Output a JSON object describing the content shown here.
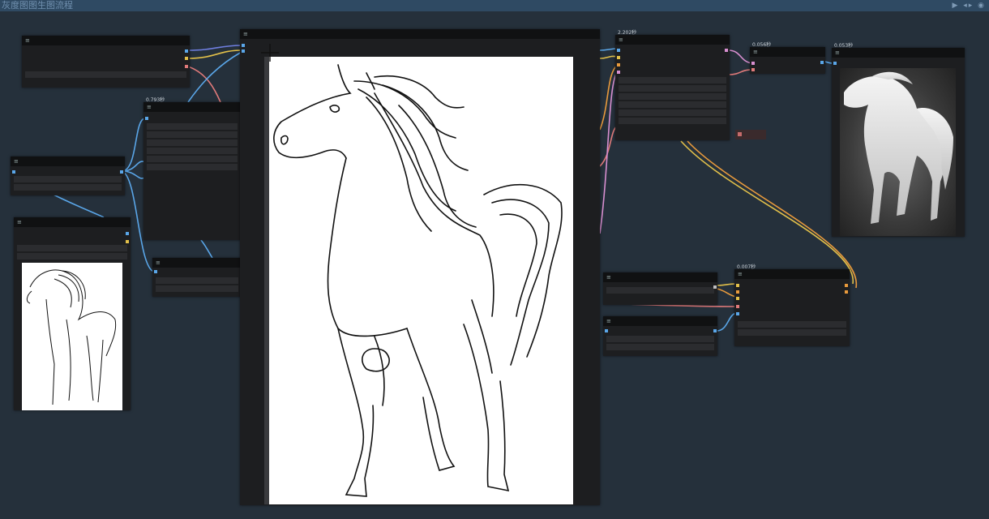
{
  "window": {
    "title": "灰度图图生图流程",
    "controls": "▶ ◂▸ ◉"
  },
  "nodes": {
    "load_image_node": {
      "menu": "≡"
    },
    "preprocess_node": {
      "menu": "≡",
      "timing": "0.793秒"
    },
    "model_loader_node": {
      "menu": "≡"
    },
    "image_preview_left": {
      "menu": "≡"
    },
    "prompt_node": {
      "menu": "≡"
    },
    "main_preview_node": {
      "menu": "≡"
    },
    "sampler_node": {
      "menu": "≡",
      "timing": "2.202秒"
    },
    "decode_node": {
      "menu": "≡",
      "timing": "0.056秒"
    },
    "output_preview_node": {
      "menu": "≡",
      "timing": "0.053秒"
    },
    "conditioning_node_a": {
      "menu": "≡"
    },
    "conditioning_node_b": {
      "menu": "≡"
    },
    "combine_node": {
      "menu": "≡",
      "timing": "0.007秒"
    }
  },
  "icons": {
    "cursor": "crosshair-icon",
    "menu": "hamburger-icon"
  },
  "colors": {
    "bg": "#25303b",
    "node": "#1d1e20",
    "header": "#101112",
    "wire_blue": "#5aa6e8",
    "wire_yellow": "#e2c04a",
    "wire_red": "#e07a7a",
    "wire_pink": "#d88fd0"
  }
}
